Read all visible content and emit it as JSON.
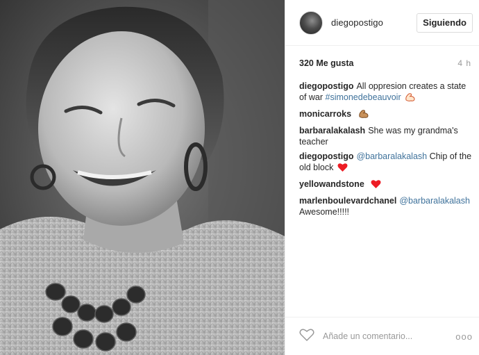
{
  "header": {
    "username": "diegopostigo",
    "follow_label": "Siguiendo"
  },
  "stats": {
    "likes": "320 Me gusta",
    "time": "4 h"
  },
  "comments": [
    {
      "author": "diegopostigo",
      "text": "All oppresion creates a state of war ",
      "hashtag": "#simonedebeauvoir",
      "emoji": "flexed-biceps"
    },
    {
      "author": "monicarroks",
      "emoji": "flexed-biceps"
    },
    {
      "author": "barbaralakalash",
      "text": "She was my grandma's teacher"
    },
    {
      "author": "diegopostigo",
      "mention": "@barbaralakalash",
      "text": " Chip of the old block ",
      "emoji": "red-heart"
    },
    {
      "author": "yellowandstone",
      "emoji": "red-heart"
    },
    {
      "author": "marlenboulevardchanel",
      "mention": "@barbaralakalash",
      "text": " Awesome!!!!!"
    }
  ],
  "footer": {
    "placeholder": "Añade un comentario...",
    "more": "ooo"
  },
  "icons": {
    "like": "heart-outline-icon",
    "more": "more-options-icon"
  },
  "colors": {
    "link": "#3f729b",
    "heart": "#ed1c24",
    "text": "#262626",
    "muted": "#999999"
  }
}
